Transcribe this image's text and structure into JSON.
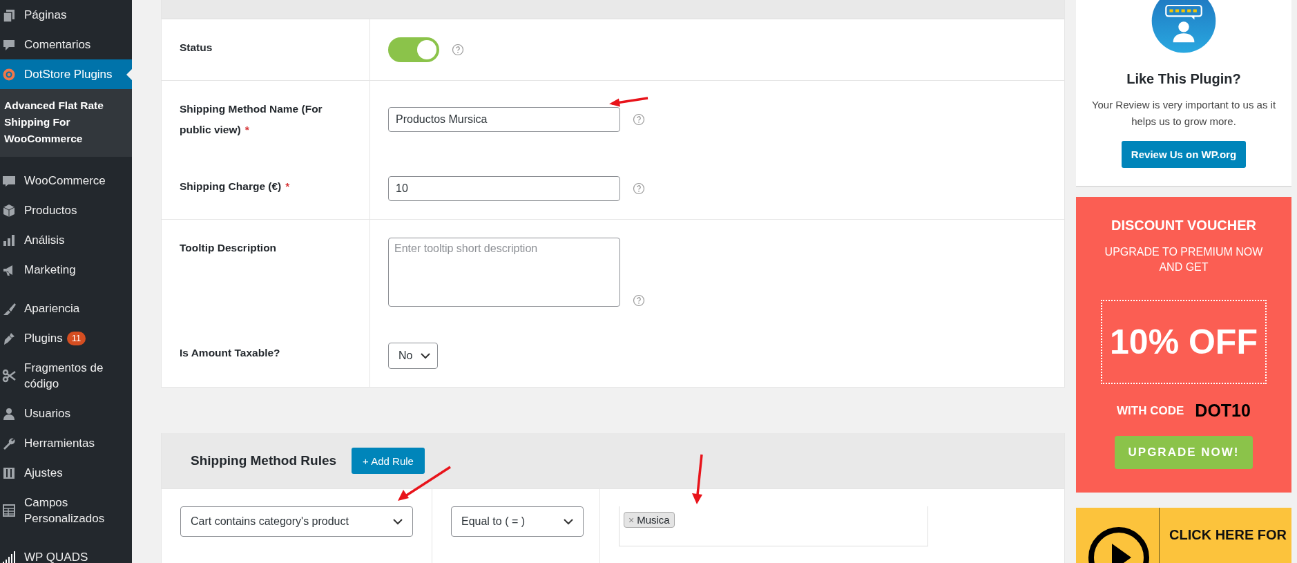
{
  "sidebar": {
    "groups": [
      {
        "items": [
          {
            "label": "Páginas",
            "selected": false
          },
          {
            "label": "Comentarios",
            "selected": false
          },
          {
            "label": "DotStore Plugins",
            "selected": true,
            "children": [
              {
                "label": "Advanced Flat Rate Shipping For WooCommerce",
                "selected": true
              }
            ]
          }
        ]
      },
      {
        "items": [
          {
            "label": "WooCommerce",
            "selected": false
          },
          {
            "label": "Productos",
            "selected": false
          },
          {
            "label": "Análisis",
            "selected": false
          },
          {
            "label": "Marketing",
            "selected": false
          }
        ]
      },
      {
        "items": [
          {
            "label": "Apariencia",
            "selected": false
          },
          {
            "label": "Plugins",
            "selected": false,
            "badge": "11"
          },
          {
            "label": "Fragmentos de código",
            "selected": false
          },
          {
            "label": "Usuarios",
            "selected": false
          },
          {
            "label": "Herramientas",
            "selected": false
          },
          {
            "label": "Ajustes",
            "selected": false
          },
          {
            "label": "Campos Personalizados",
            "selected": false
          }
        ]
      },
      {
        "items": [
          {
            "label": "WP QUADS",
            "selected": false
          }
        ]
      }
    ]
  },
  "configuration": {
    "rows": [
      {
        "fields": [
          {
            "kind": "toggle",
            "label": "Status",
            "on": true,
            "help": true
          }
        ]
      },
      {
        "fields": [
          {
            "kind": "text",
            "label": "Shipping Method Name (For public view)",
            "required_mark": "*",
            "value": "Productos Mursica",
            "help": true
          },
          {
            "kind": "text",
            "label": "Shipping Charge (€)",
            "required_mark": "*",
            "value": "10",
            "help": true
          }
        ]
      },
      {
        "fields": [
          {
            "kind": "textarea",
            "label": "Tooltip Description",
            "placeholder": "Enter tooltip short description",
            "help": true
          },
          {
            "kind": "select",
            "label": "Is Amount Taxable?",
            "value": "No",
            "help": false
          }
        ]
      }
    ]
  },
  "rules": {
    "title": "Shipping Method Rules",
    "add_button": "+ Add Rule",
    "rows": [
      {
        "condition": "Cart contains category's product",
        "operator": "Equal to ( = )",
        "tags": [
          {
            "remove": "×",
            "label": "Musica"
          }
        ]
      }
    ]
  },
  "review_card": {
    "title": "Like This Plugin?",
    "text": "Your Review is very important to us as it helps us to grow more.",
    "button": "Review Us on WP.org"
  },
  "voucher": {
    "title": "DISCOUNT VOUCHER",
    "subtitle": "UPGRADE TO PREMIUM NOW AND GET",
    "offer": "10% OFF",
    "code_label": "WITH CODE",
    "code": "DOT10",
    "button": "UPGRADE NOW!"
  },
  "video_banner": {
    "text": "CLICK HERE FOR"
  }
}
